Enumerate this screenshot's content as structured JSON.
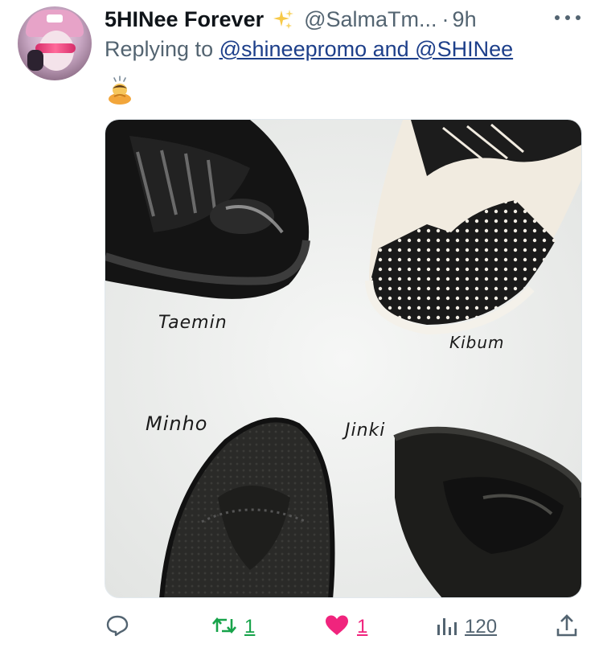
{
  "tweet": {
    "display_name": "5HINee Forever",
    "handle": "@SalmaTm...",
    "separator": "·",
    "time": "9h",
    "reply_prefix": "Replying to",
    "reply_to": "@shineepromo and @SHINee",
    "emoji_icon": "person-bowing-emoji"
  },
  "media": {
    "labels": {
      "taemin": "Taemin",
      "kibum": "Kibum",
      "minho": "Minho",
      "jinki": "Jinki"
    }
  },
  "actions": {
    "reply": {
      "icon": "reply-icon",
      "count": ""
    },
    "retweet": {
      "icon": "retweet-icon",
      "count": "1",
      "color": "#17a34a"
    },
    "like": {
      "icon": "heart-icon",
      "count": "1",
      "color": "#f0247d"
    },
    "views": {
      "icon": "views-icon",
      "count": "120"
    },
    "share": {
      "icon": "share-icon"
    }
  }
}
